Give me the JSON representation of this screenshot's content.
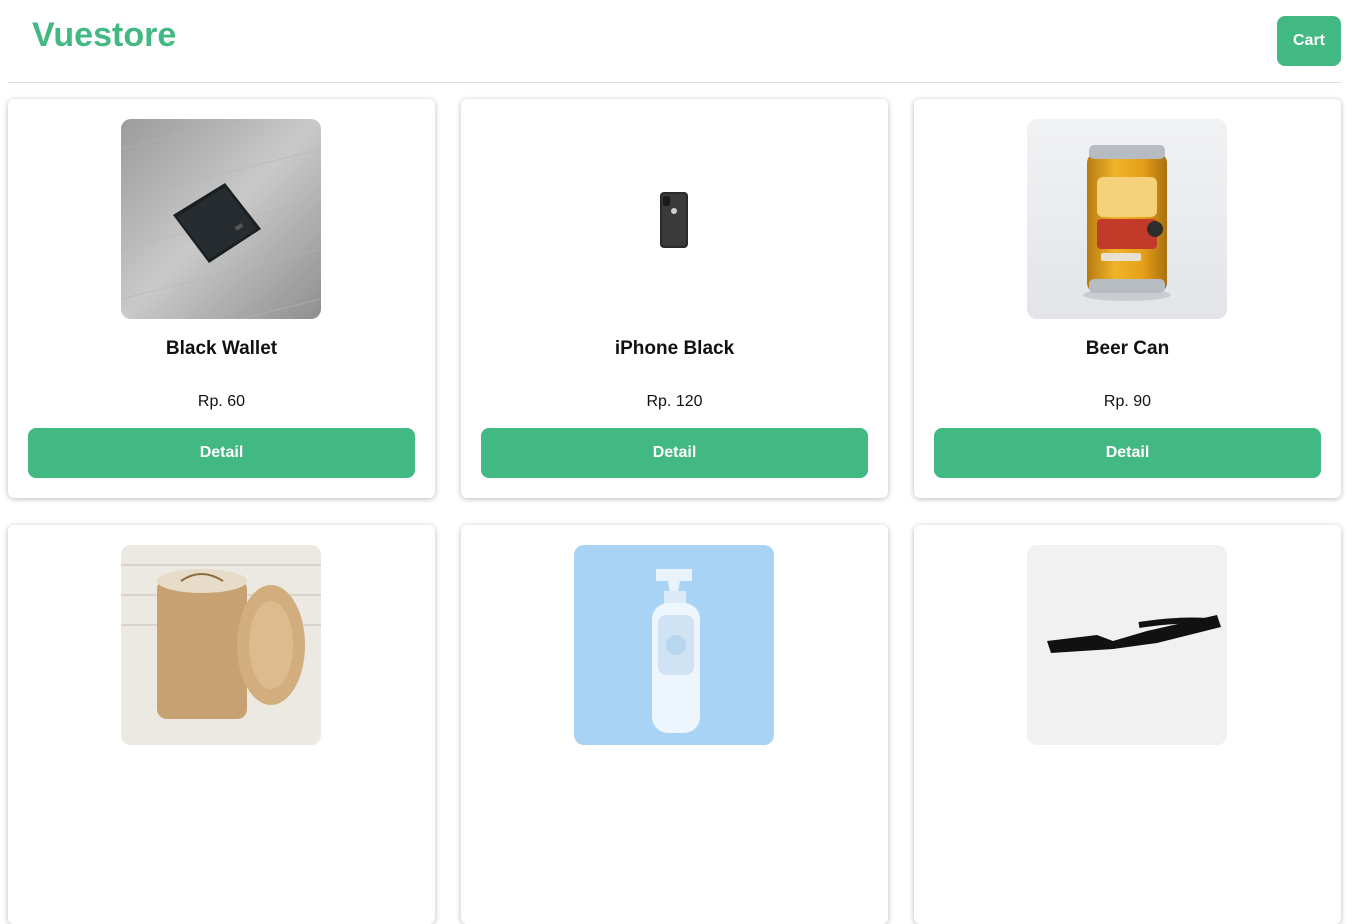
{
  "header": {
    "brand": "Vuestore",
    "cart_label": "Cart",
    "accent_color": "#42b883"
  },
  "products": [
    {
      "name": "Black Wallet",
      "price": "Rp. 60",
      "detail_label": "Detail",
      "image": "black-wallet-photo"
    },
    {
      "name": "iPhone Black",
      "price": "Rp. 120",
      "detail_label": "Detail",
      "image": "iphone-black-photo"
    },
    {
      "name": "Beer Can",
      "price": "Rp. 90",
      "detail_label": "Detail",
      "image": "ginger-beer-can-photo"
    },
    {
      "image": "bamboo-candle-jar-photo"
    },
    {
      "image": "air-freshener-spray-photo"
    },
    {
      "image": "black-sunglasses-photo"
    }
  ]
}
